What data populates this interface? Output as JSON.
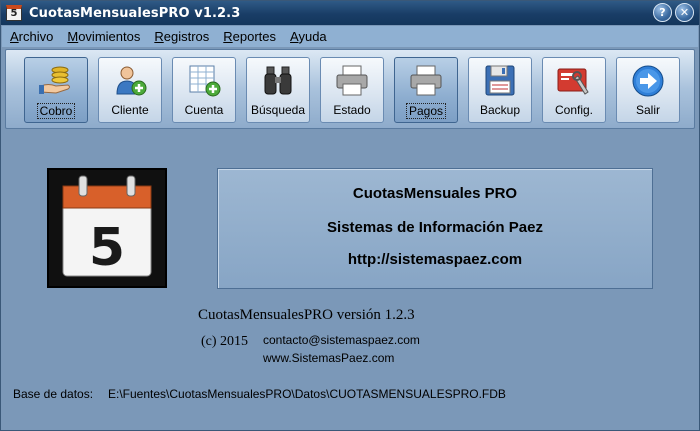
{
  "window": {
    "title": "CuotasMensualesPRO v1.2.3",
    "app_icon_text": "5",
    "help_glyph": "?",
    "close_glyph": "✕"
  },
  "menu": [
    {
      "label": "Archivo",
      "underline": "A",
      "rest": "rchivo"
    },
    {
      "label": "Movimientos",
      "underline": "M",
      "rest": "ovimientos"
    },
    {
      "label": "Registros",
      "underline": "R",
      "rest": "egistros"
    },
    {
      "label": "Reportes",
      "underline": "R",
      "rest": "eportes"
    },
    {
      "label": "Ayuda",
      "underline": "A",
      "rest": "yuda"
    }
  ],
  "toolbar": [
    {
      "label": "Cobro",
      "icon": "coins-hand-icon",
      "active": true
    },
    {
      "label": "Cliente",
      "icon": "add-user-icon",
      "active": false
    },
    {
      "label": "Cuenta",
      "icon": "add-sheet-icon",
      "active": false
    },
    {
      "label": "Búsqueda",
      "icon": "binoculars-icon",
      "active": false
    },
    {
      "label": "Estado",
      "icon": "printer-icon",
      "active": false
    },
    {
      "label": "Pagos",
      "icon": "printer-icon",
      "active": true
    },
    {
      "label": "Backup",
      "icon": "floppy-disk-icon",
      "active": false
    },
    {
      "label": "Config.",
      "icon": "settings-card-icon",
      "active": false
    },
    {
      "label": "Salir",
      "icon": "exit-arrow-icon",
      "active": false
    }
  ],
  "logo": {
    "digit": "5",
    "icon": "calendar-icon"
  },
  "info_panel": {
    "line1": "CuotasMensuales PRO",
    "line2": "Sistemas de Información Paez",
    "line3": "http://sistemaspaez.com"
  },
  "about": {
    "version": "CuotasMensualesPRO versión 1.2.3",
    "copyright": "(c) 2015",
    "email": "contacto@sistemaspaez.com",
    "website": "www.SistemasPaez.com"
  },
  "database": {
    "label": "Base de datos:",
    "path": "E:\\Fuentes\\CuotasMensualesPRO\\Datos\\CUOTASMENSUALESPRO.FDB"
  }
}
